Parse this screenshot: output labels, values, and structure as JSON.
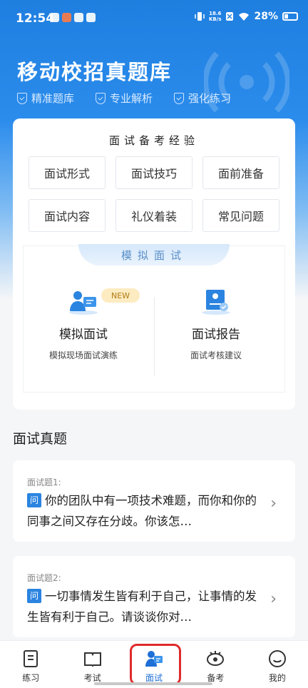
{
  "status_bar": {
    "time": "12:54",
    "network_speed_top": "18.6",
    "network_speed_unit": "KB/s",
    "battery": "28%"
  },
  "header": {
    "title": "移动校招真题库",
    "features": [
      "精准题库",
      "专业解析",
      "强化练习"
    ]
  },
  "experience": {
    "heading": "面试备考经验",
    "items": [
      "面试形式",
      "面试技巧",
      "面前准备",
      "面试内容",
      "礼仪着装",
      "常见问题"
    ]
  },
  "mock": {
    "banner": "模拟面试",
    "left": {
      "label": "模拟面试",
      "sub": "模拟现场面试演练",
      "badge": "NEW"
    },
    "right": {
      "label": "面试报告",
      "sub": "面试考核建议"
    }
  },
  "questions_section": {
    "title": "面试真题",
    "tag": "问",
    "items": [
      {
        "number": "面试题1:",
        "text": "你的团队中有一项技术难题，而你和你的同事之间又存在分歧。你该怎…"
      },
      {
        "number": "面试题2:",
        "text": "一切事情发生皆有利于自己，让事情的发生皆有利于自己。请谈谈你对…"
      }
    ]
  },
  "tabbar": {
    "tabs": [
      {
        "label": "练习",
        "icon": "practice-icon"
      },
      {
        "label": "考试",
        "icon": "exam-icon"
      },
      {
        "label": "面试",
        "icon": "interview-icon",
        "active": true
      },
      {
        "label": "备考",
        "icon": "prepare-icon"
      },
      {
        "label": "我的",
        "icon": "profile-icon"
      }
    ],
    "active_color": "#1e6fd6",
    "highlight_color": "#e02b2b"
  },
  "colors": {
    "primary": "#2b84e0",
    "hero_top": "#1f7fe0"
  }
}
